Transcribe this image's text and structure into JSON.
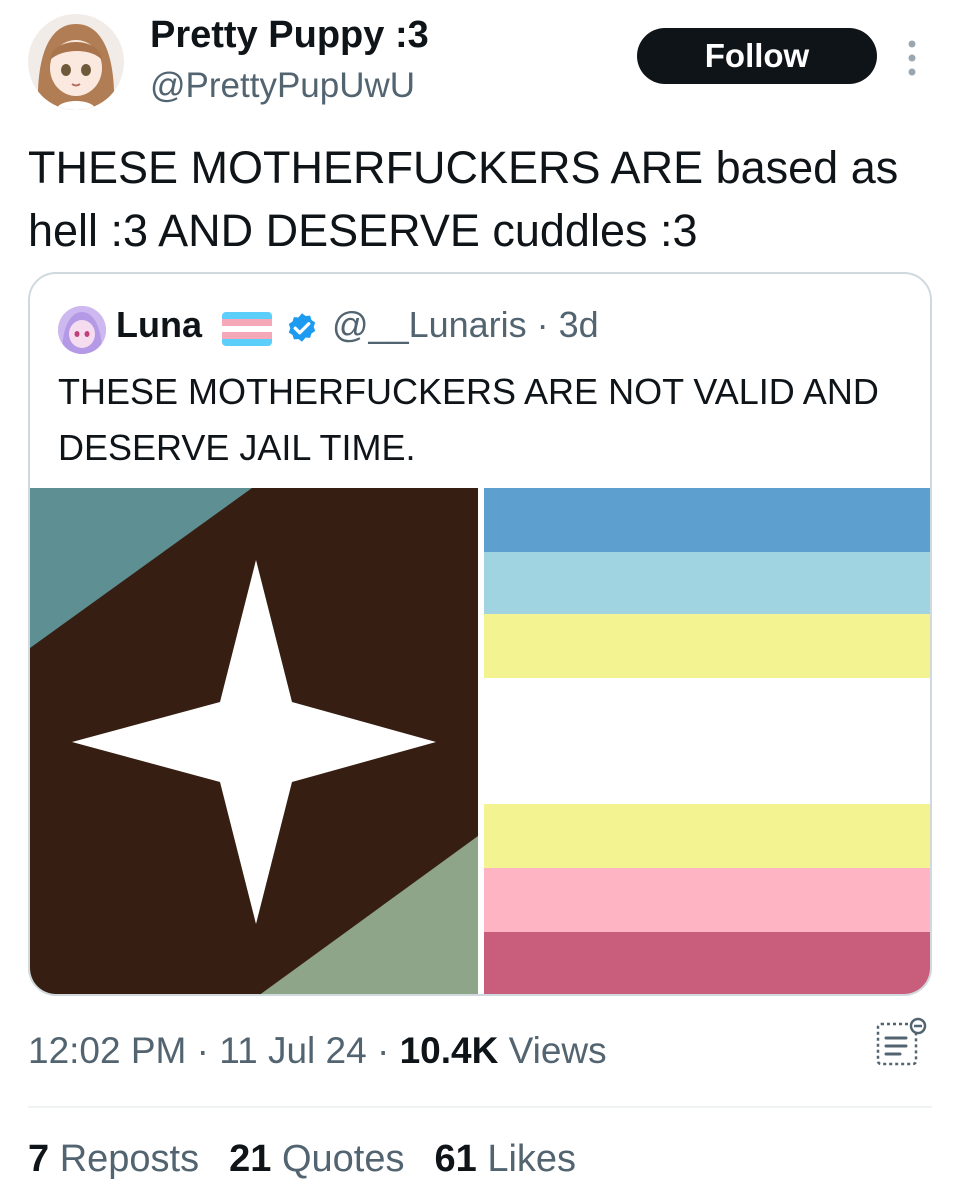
{
  "author": {
    "display_name": "Pretty Puppy :3",
    "handle": "@PrettyPupUwU",
    "avatar_icon": "anime-girl-avatar"
  },
  "actions": {
    "follow_label": "Follow",
    "more_icon": "more-vertical-icon"
  },
  "tweet": {
    "text": "THESE MOTHERFUCKERS ARE based as hell :3 AND DESERVE cuddles :3"
  },
  "quote": {
    "name": "Luna",
    "handle_time": "@__Lunaris · 3d",
    "text": "THESE MOTHERFUCKERS ARE NOT VALID AND DESERVE JAIL TIME.",
    "badge_flag_colors": [
      "#5bcefa",
      "#f5a9b8",
      "#ffffff",
      "#f5a9b8",
      "#5bcefa"
    ],
    "verified_color": "#1d9bf0",
    "left_flag_colors": {
      "background": "#361f12",
      "top_left": "#5e8f93",
      "bottom_right": "#8ea58a",
      "star": "#ffffff"
    },
    "right_flag_colors": [
      "#5da0d0",
      "#9fd4e0",
      "#f4f391",
      "#ffffff",
      "#f4f391",
      "#ffb4c3",
      "#c95d7c"
    ]
  },
  "meta": {
    "time": "12:02 PM",
    "date": "11 Jul 24",
    "views_count": "10.4K",
    "views_label": "Views"
  },
  "stats": {
    "reposts_count": "7",
    "reposts_label": "Reposts",
    "quotes_count": "21",
    "quotes_label": "Quotes",
    "likes_count": "61",
    "likes_label": "Likes"
  }
}
